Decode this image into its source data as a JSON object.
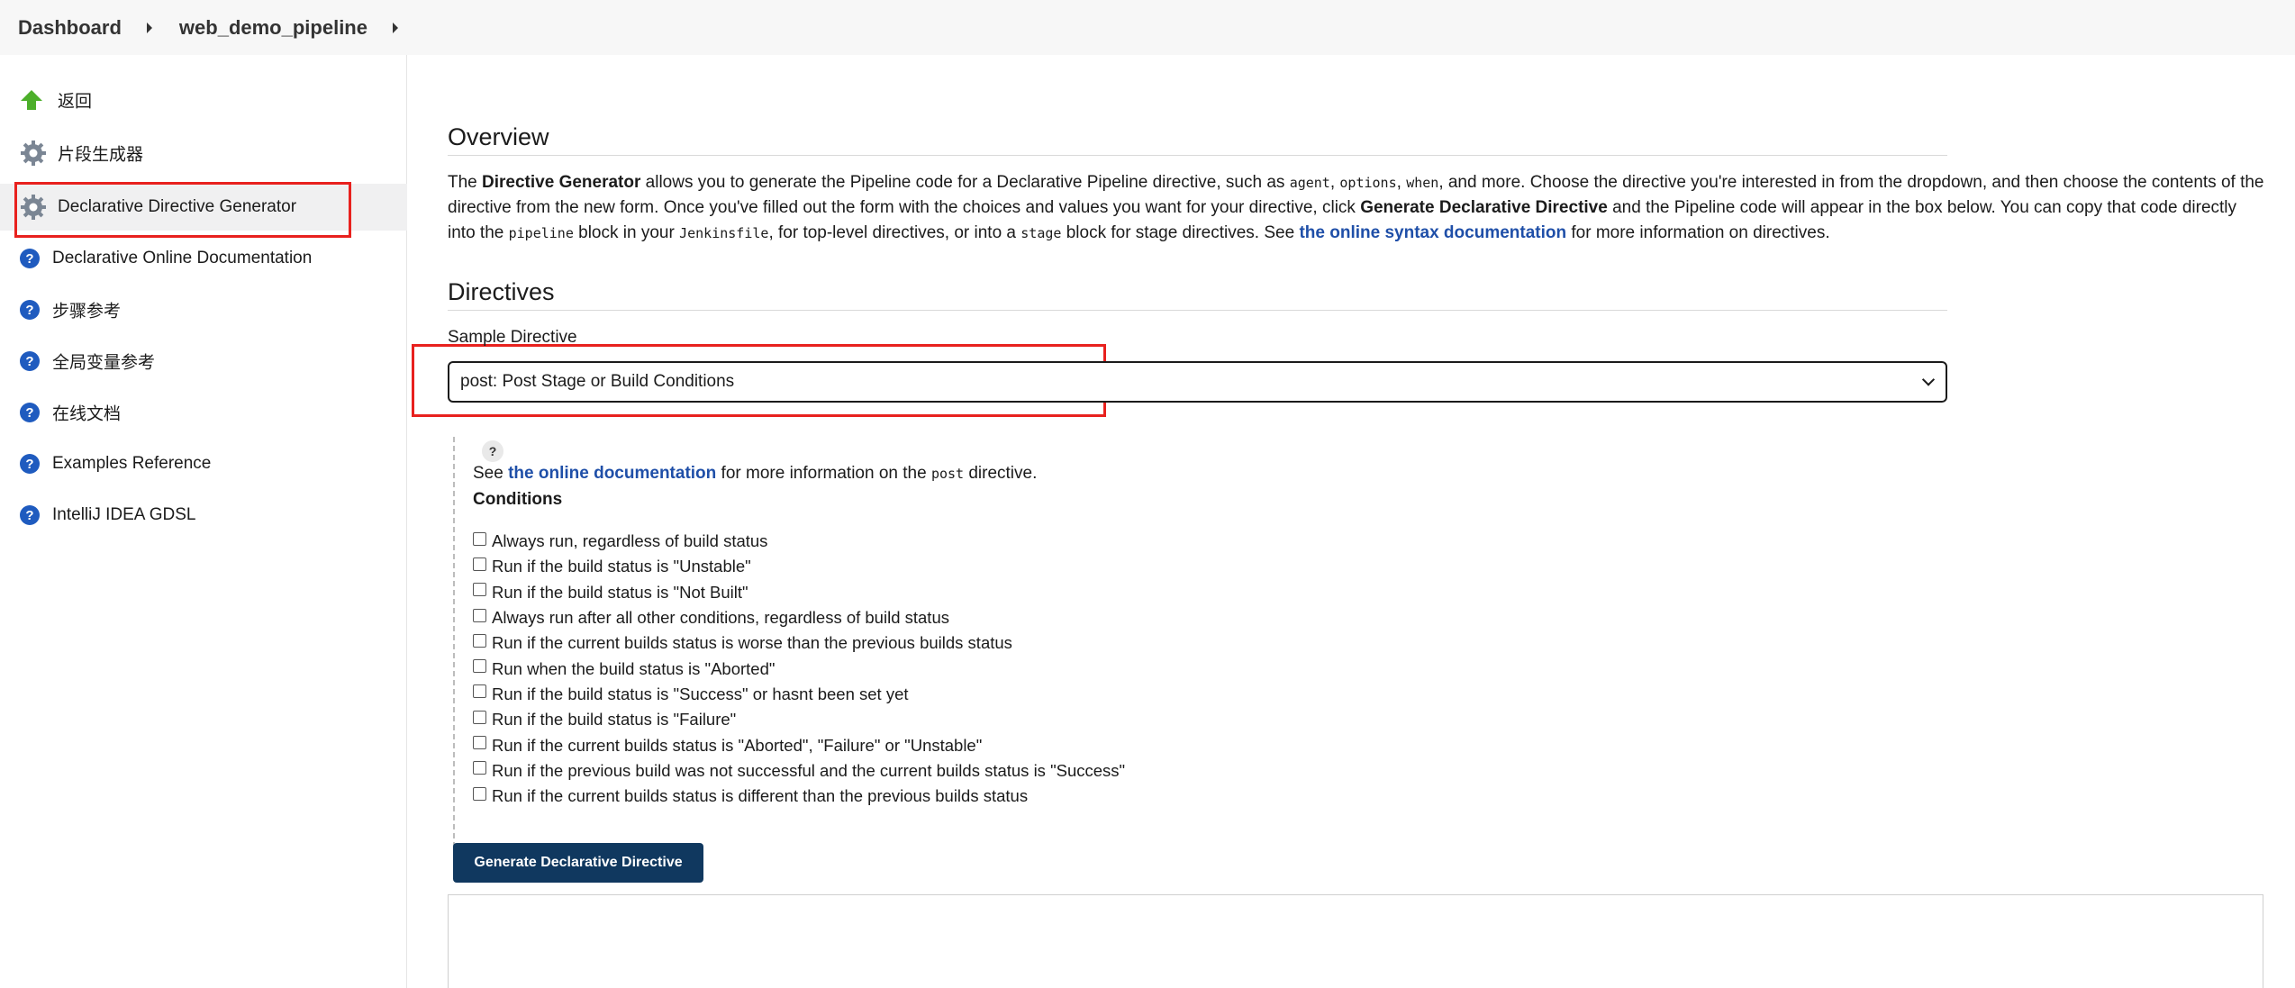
{
  "breadcrumb": {
    "items": [
      "Dashboard",
      "web_demo_pipeline"
    ]
  },
  "sidebar": {
    "items": [
      {
        "label": "返回",
        "icon": "arrow-up-icon"
      },
      {
        "label": "片段生成器",
        "icon": "gear-icon"
      },
      {
        "label": "Declarative Directive Generator",
        "icon": "gear-icon"
      },
      {
        "label": "Declarative Online Documentation",
        "icon": "help-icon"
      },
      {
        "label": "步骤参考",
        "icon": "help-icon"
      },
      {
        "label": "全局变量参考",
        "icon": "help-icon"
      },
      {
        "label": "在线文档",
        "icon": "help-icon"
      },
      {
        "label": "Examples Reference",
        "icon": "help-icon"
      },
      {
        "label": "IntelliJ IDEA GDSL",
        "icon": "help-icon"
      }
    ]
  },
  "overview": {
    "title": "Overview",
    "p1": "The ",
    "b1": "Directive Generator",
    "p2": " allows you to generate the Pipeline code for a Declarative Pipeline directive, such as ",
    "c1": "agent",
    "s1": ", ",
    "c2": "options",
    "s2": ", ",
    "c3": "when",
    "p3": ", and more. Choose the directive you're interested in from the dropdown, and then choose the contents of the directive from the new form. Once you've filled out the form with the choices and values you want for your directive, click ",
    "b2": "Generate Declarative Directive",
    "p4": " and the Pipeline code will appear in the box below. You can copy that code directly into the ",
    "c4": "pipeline",
    "p5": " block in your ",
    "c5": "Jenkinsfile",
    "p6": ", for top-level directives, or into a ",
    "c6": "stage",
    "p7": " block for stage directives. See ",
    "link": "the online syntax documentation",
    "p8": " for more information on directives."
  },
  "directives": {
    "title": "Directives",
    "field_label": "Sample Directive",
    "selected": "post: Post Stage or Build Conditions"
  },
  "post": {
    "help": "?",
    "see": "See ",
    "link": "the online documentation",
    "mid": " for more information on the ",
    "code": "post",
    "end": " directive.",
    "conditions_title": "Conditions",
    "conditions": [
      "Always run, regardless of build status",
      "Run if the build status is \"Unstable\"",
      "Run if the build status is \"Not Built\"",
      "Always run after all other conditions, regardless of build status",
      "Run if the current builds status is worse than the previous builds status",
      "Run when the build status is \"Aborted\"",
      "Run if the build status is \"Success\" or hasnt been set yet",
      "Run if the build status is \"Failure\"",
      "Run if the current builds status is \"Aborted\", \"Failure\" or \"Unstable\"",
      "Run if the previous build was not successful and the current builds status is \"Success\"",
      "Run if the current builds status is different than the previous builds status"
    ]
  },
  "generate_button": "Generate Declarative Directive",
  "colors": {
    "accent": "#10385f",
    "link": "#1f4fa8",
    "help_icon": "#1f5bbf",
    "annotation": "#e8211e"
  }
}
